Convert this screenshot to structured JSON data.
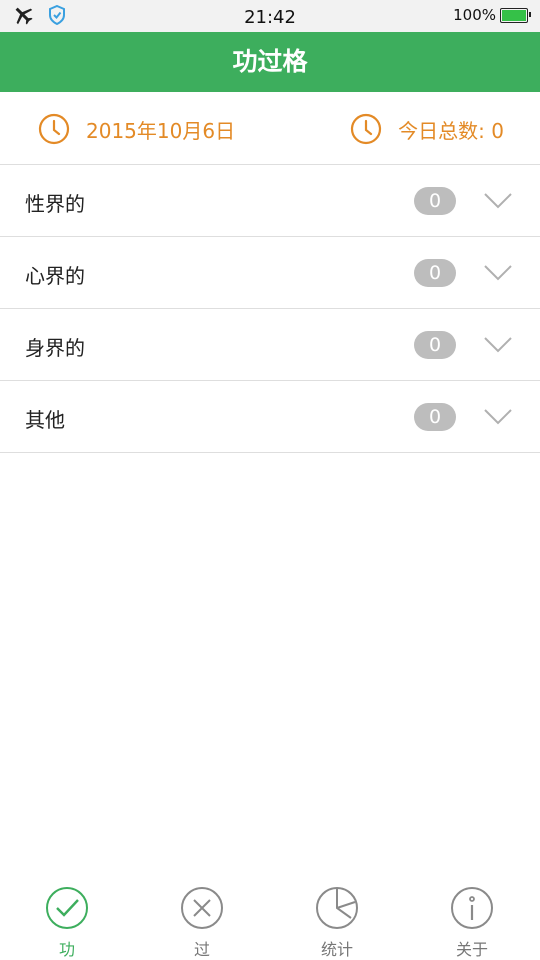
{
  "status_bar": {
    "time": "21:42",
    "battery": "100%"
  },
  "header": {
    "title": "功过格"
  },
  "info": {
    "date": "2015年10月6日",
    "total_label": "今日总数: 0"
  },
  "categories": [
    {
      "label": "性界的",
      "count": "0"
    },
    {
      "label": "心界的",
      "count": "0"
    },
    {
      "label": "身界的",
      "count": "0"
    },
    {
      "label": "其他",
      "count": "0"
    }
  ],
  "tabs": [
    {
      "label": "功",
      "icon": "check-circle-icon",
      "active": true
    },
    {
      "label": "过",
      "icon": "x-circle-icon",
      "active": false
    },
    {
      "label": "统计",
      "icon": "pie-chart-icon",
      "active": false
    },
    {
      "label": "关于",
      "icon": "info-circle-icon",
      "active": false
    }
  ],
  "colors": {
    "accent": "#3dae5d",
    "date_text": "#e38a26",
    "badge": "#bdbdbd"
  }
}
